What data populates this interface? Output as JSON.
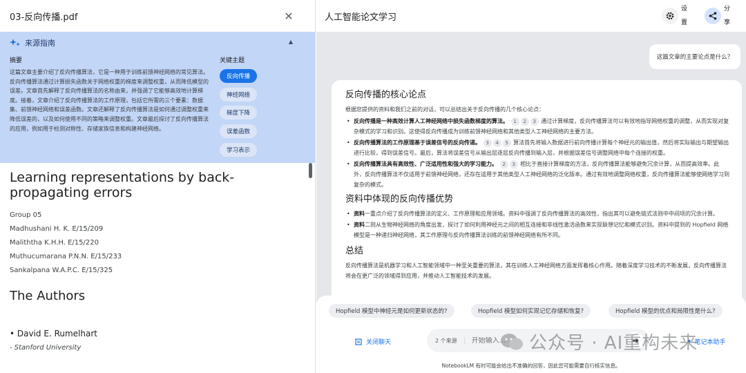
{
  "left": {
    "file_title": "03-反向传播.pdf",
    "guide": {
      "title": "来源指南",
      "summary_label": "摘要",
      "summary_text": "这篇文章主要介绍了反向传播算法，它是一种用于训练前馈神经网络的常见算法。反向传播算法通过计算损失函数关于网络权重的梯度来调整权重，从而降低模型的误差。文章首先解释了反向传播算法的名称由来，并强调了它能够高效地计算梯度。接着，文章介绍了反向传播算法的工作原理，包括它所需的三个要素：数据集、前馈神经网络和误差函数。文章还解释了反向传播算法是如何通过调整权重来降低误差的，以及如何使用不同的策略来调整权重。文章最后探讨了反向传播算法的应用，例如用于检测对称性、存储家族信息和构建神经网络。",
      "topics_label": "关键主题",
      "topics": [
        "反向传播",
        "神经网络",
        "梯度下降",
        "误差函数",
        "学习表示"
      ]
    },
    "doc": {
      "title": "Learning representations by back-propagating errors",
      "lines": [
        "Group 05",
        "Madhushani H. K. E/15/209",
        "Maliththa K.H.H. E/15/220",
        "Muthucumarana P.N.N. E/15/233",
        "Sankalpana W.A.P.C. E/15/325"
      ],
      "authors_heading": "The Authors",
      "author_name": "• David E. Rumelhart",
      "author_affil": "- Stanford University"
    }
  },
  "right": {
    "notebook_title": "人工智能论文学习",
    "settings_label": [
      "设",
      "置"
    ],
    "share_label": [
      "分",
      "享"
    ],
    "user_question": "这篇文章的主要论点是什么？",
    "answer": {
      "h1": "反向传播的核心论点",
      "intro": "根据您提供的资料和我们之前的对话，可以总结出关于反向传播的几个核心论点：",
      "points": [
        {
          "bold": "反向传播是一种高效计算人工神经网络中损失函数梯度的算法。",
          "cites": [
            "1",
            "2",
            "3"
          ],
          "text": "通过计算梯度，反向传播算法可以有效地指导网络权重的调整，从而实现对复杂模式的学习和识别。这使得反向传播成为训练前馈神经网络和其他类型人工神经网络的主要方法。"
        },
        {
          "bold": "反向传播算法的工作原理基于误差信号的反向传递。",
          "cites": [
            "3",
            "4",
            "5"
          ],
          "text": "算法首先将输入数据进行前向传播计算每个神经元的输出值，然后将实际输出与期望输出进行比较，得到误差信号。最后，算法将误差信号从输出层逐层反向传播到输入层，并根据误差信号调整网络中每个连接的权重。"
        },
        {
          "bold": "反向传播算法具有高效性、广泛适用性和强大的学习能力。",
          "cites": [
            "2",
            "3"
          ],
          "text": "相比于直接计算梯度的方法，反向传播算法能够避免冗余计算，从而提高效率。此外，反向传播算法不仅适用于前馈神经网络，还存在适用于其他类型人工神经网络的泛化版本。通过有效地调整网络权重，反向传播算法能够使网络学习到复杂的模式。"
        }
      ],
      "h2": "资料中体现的反向传播优势",
      "sources": [
        {
          "bold": "资料",
          "text": "一重点介绍了反向传播算法的定义、工作原理和应用领域。资料中强调了反向传播算法的高效性，指出其可以避免链式法则中中间项的冗余计算。"
        },
        {
          "bold": "资料",
          "text": "二则从生物神经网络的角度出发，探讨了如何利用神经元之间的相互连接和非线性激活函数来实现联想记忆和模式识别。资料中提到的 Hopfield 网络模型是一种递归神经网络，其工作原理与反向传播算法训练的前馈神经网络有所不同。"
        }
      ],
      "h3": "总结",
      "conclusion": "反向传播算法是机器学习和人工智能领域中一种至关重要的算法，其在训练人工神经网络方面发挥着核心作用。随着深度学习技术的不断发展，反向传播算法将会在更广泛的领域得到应用，并推动人工智能技术的发展。"
    },
    "suggestions": [
      "Hopfield 模型中神经元是如何更新状态的?",
      "Hopfield 模型如何实现记忆存储和恢复?",
      "Hopfield 模型的优点和局限性是什么?"
    ],
    "close_chat": "关闭聊天",
    "source_count": "2 个来源",
    "input_placeholder": "开始输入...",
    "assistant_label": "笔记本助手",
    "disclaimer": "NotebookLM 有时可能会给出不准确的回答，因此您可能需要自行核实信息。"
  },
  "watermark": "公众号 · AI重构未来",
  "colors": {
    "accent": "#1a73e8",
    "guide_bg": "#c2d6f7",
    "chat_bg": "#e6e7ea"
  }
}
